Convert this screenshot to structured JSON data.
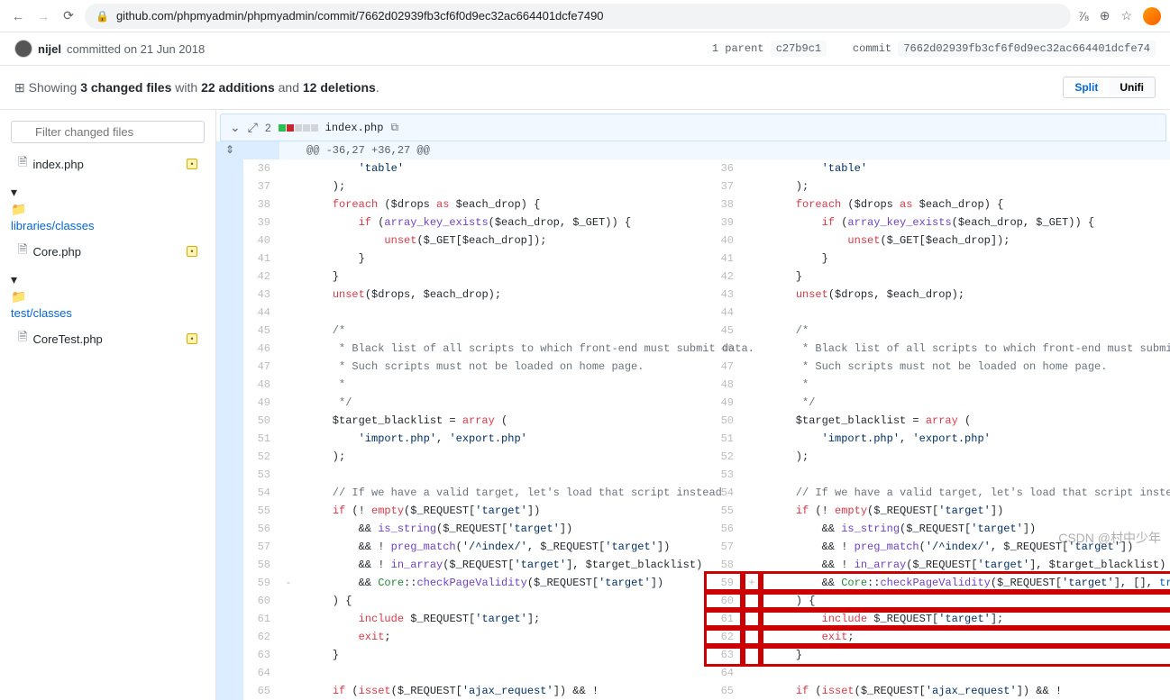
{
  "browser": {
    "url": "github.com/phpmyadmin/phpmyadmin/commit/7662d02939fb3cf6f0d9ec32ac664401dcfe7490"
  },
  "commit": {
    "author": "nijel",
    "committed_text": "committed on 21 Jun 2018",
    "parent_label": "1 parent",
    "parent_sha": "c27b9c1",
    "commit_label": "commit",
    "full_sha": "7662d02939fb3cf6f0d9ec32ac664401dcfe74"
  },
  "diffbar": {
    "showing": "Showing",
    "changed_files": "3 changed files",
    "with": "with",
    "additions": "22 additions",
    "and": "and",
    "deletions": "12 deletions",
    "split_btn": "Split",
    "unified_btn": "Unifi"
  },
  "sidebar": {
    "filter_placeholder": "Filter changed files",
    "files": [
      {
        "name": "index.php"
      },
      {
        "name": "Core.php"
      },
      {
        "name": "CoreTest.php"
      }
    ],
    "folders": [
      {
        "path": "libraries/classes"
      },
      {
        "path": "test/classes"
      }
    ]
  },
  "file_header": {
    "count": "2",
    "path": "index.php"
  },
  "hunk_header": "@@ -36,27 +36,27 @@",
  "lines_left": [
    {
      "n": "36",
      "m": "",
      "c": "        'table'"
    },
    {
      "n": "37",
      "m": "",
      "c": "    );"
    },
    {
      "n": "38",
      "m": "",
      "c": "    foreach ($drops as $each_drop) {"
    },
    {
      "n": "39",
      "m": "",
      "c": "        if (array_key_exists($each_drop, $_GET)) {"
    },
    {
      "n": "40",
      "m": "",
      "c": "            unset($_GET[$each_drop]);"
    },
    {
      "n": "41",
      "m": "",
      "c": "        }"
    },
    {
      "n": "42",
      "m": "",
      "c": "    }"
    },
    {
      "n": "43",
      "m": "",
      "c": "    unset($drops, $each_drop);"
    },
    {
      "n": "44",
      "m": "",
      "c": ""
    },
    {
      "n": "45",
      "m": "",
      "c": "    /*"
    },
    {
      "n": "46",
      "m": "",
      "c": "     * Black list of all scripts to which front-end must submit data."
    },
    {
      "n": "47",
      "m": "",
      "c": "     * Such scripts must not be loaded on home page."
    },
    {
      "n": "48",
      "m": "",
      "c": "     *"
    },
    {
      "n": "49",
      "m": "",
      "c": "     */"
    },
    {
      "n": "50",
      "m": "",
      "c": "    $target_blacklist = array ("
    },
    {
      "n": "51",
      "m": "",
      "c": "        'import.php', 'export.php'"
    },
    {
      "n": "52",
      "m": "",
      "c": "    );"
    },
    {
      "n": "53",
      "m": "",
      "c": ""
    },
    {
      "n": "54",
      "m": "",
      "c": "    // If we have a valid target, let's load that script instead"
    },
    {
      "n": "55",
      "m": "",
      "c": "    if (! empty($_REQUEST['target'])"
    },
    {
      "n": "56",
      "m": "",
      "c": "        && is_string($_REQUEST['target'])"
    },
    {
      "n": "57",
      "m": "",
      "c": "        && ! preg_match('/^index/', $_REQUEST['target'])"
    },
    {
      "n": "58",
      "m": "",
      "c": "        && ! in_array($_REQUEST['target'], $target_blacklist)"
    },
    {
      "n": "59",
      "m": "-",
      "c": "        && Core::checkPageValidity($_REQUEST['target'])",
      "t": "del"
    },
    {
      "n": "60",
      "m": "",
      "c": "    ) {"
    },
    {
      "n": "61",
      "m": "",
      "c": "        include $_REQUEST['target'];"
    },
    {
      "n": "62",
      "m": "",
      "c": "        exit;"
    },
    {
      "n": "63",
      "m": "",
      "c": "    }"
    },
    {
      "n": "64",
      "m": "",
      "c": ""
    },
    {
      "n": "65",
      "m": "",
      "c": "    if (isset($_REQUEST['ajax_request']) && !"
    }
  ],
  "lines_right": [
    {
      "n": "36",
      "m": "",
      "c": "        'table'"
    },
    {
      "n": "37",
      "m": "",
      "c": "    );"
    },
    {
      "n": "38",
      "m": "",
      "c": "    foreach ($drops as $each_drop) {"
    },
    {
      "n": "39",
      "m": "",
      "c": "        if (array_key_exists($each_drop, $_GET)) {"
    },
    {
      "n": "40",
      "m": "",
      "c": "            unset($_GET[$each_drop]);"
    },
    {
      "n": "41",
      "m": "",
      "c": "        }"
    },
    {
      "n": "42",
      "m": "",
      "c": "    }"
    },
    {
      "n": "43",
      "m": "",
      "c": "    unset($drops, $each_drop);"
    },
    {
      "n": "44",
      "m": "",
      "c": ""
    },
    {
      "n": "45",
      "m": "",
      "c": "    /*"
    },
    {
      "n": "46",
      "m": "",
      "c": "     * Black list of all scripts to which front-end must submit data."
    },
    {
      "n": "47",
      "m": "",
      "c": "     * Such scripts must not be loaded on home page."
    },
    {
      "n": "48",
      "m": "",
      "c": "     *"
    },
    {
      "n": "49",
      "m": "",
      "c": "     */"
    },
    {
      "n": "50",
      "m": "",
      "c": "    $target_blacklist = array ("
    },
    {
      "n": "51",
      "m": "",
      "c": "        'import.php', 'export.php'"
    },
    {
      "n": "52",
      "m": "",
      "c": "    );"
    },
    {
      "n": "53",
      "m": "",
      "c": ""
    },
    {
      "n": "54",
      "m": "",
      "c": "    // If we have a valid target, let's load that script instead"
    },
    {
      "n": "55",
      "m": "",
      "c": "    if (! empty($_REQUEST['target'])"
    },
    {
      "n": "56",
      "m": "",
      "c": "        && is_string($_REQUEST['target'])"
    },
    {
      "n": "57",
      "m": "",
      "c": "        && ! preg_match('/^index/', $_REQUEST['target'])"
    },
    {
      "n": "58",
      "m": "",
      "c": "        && ! in_array($_REQUEST['target'], $target_blacklist)"
    },
    {
      "n": "59",
      "m": "+",
      "c": "        && Core::checkPageValidity($_REQUEST['target'], [], true)",
      "t": "add",
      "hl": true
    },
    {
      "n": "60",
      "m": "",
      "c": "    ) {",
      "hl": true
    },
    {
      "n": "61",
      "m": "",
      "c": "        include $_REQUEST['target'];",
      "hl": true
    },
    {
      "n": "62",
      "m": "",
      "c": "        exit;",
      "hl": true
    },
    {
      "n": "63",
      "m": "",
      "c": "    }",
      "hl": true
    },
    {
      "n": "64",
      "m": "",
      "c": ""
    },
    {
      "n": "65",
      "m": "",
      "c": "    if (isset($_REQUEST['ajax_request']) && !"
    }
  ],
  "watermark": "CSDN @村中少年"
}
